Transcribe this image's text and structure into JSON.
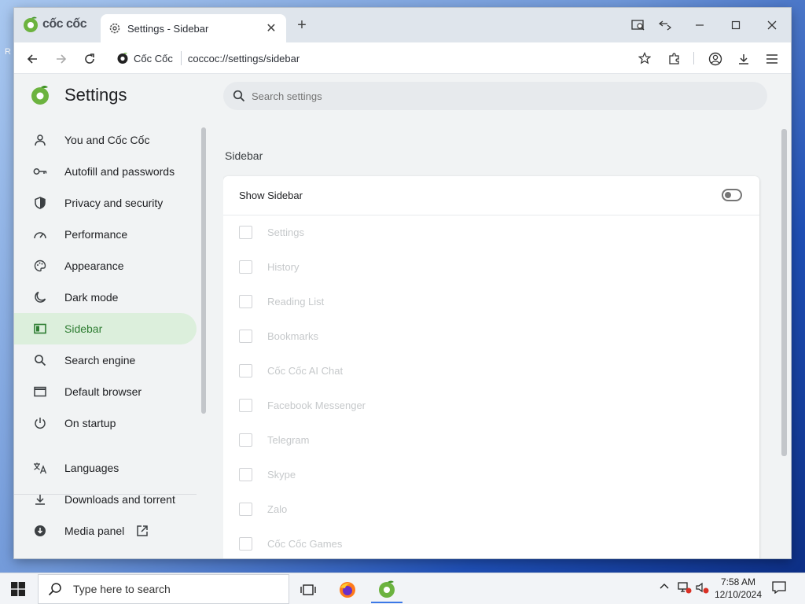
{
  "browser": {
    "brand": "cốc cốc",
    "tab_title": "Settings - Sidebar",
    "site_chip": "Cốc Cốc",
    "url": "coccoc://settings/sidebar"
  },
  "settings": {
    "title": "Settings",
    "search_placeholder": "Search settings",
    "nav": [
      {
        "label": "You and Cốc Cốc",
        "icon": "person-icon",
        "active": false
      },
      {
        "label": "Autofill and passwords",
        "icon": "key-icon",
        "active": false
      },
      {
        "label": "Privacy and security",
        "icon": "shield-icon",
        "active": false
      },
      {
        "label": "Performance",
        "icon": "speedometer-icon",
        "active": false
      },
      {
        "label": "Appearance",
        "icon": "palette-icon",
        "active": false
      },
      {
        "label": "Dark mode",
        "icon": "moon-icon",
        "active": false
      },
      {
        "label": "Sidebar",
        "icon": "sidebar-icon",
        "active": true
      },
      {
        "label": "Search engine",
        "icon": "search-icon",
        "active": false
      },
      {
        "label": "Default browser",
        "icon": "browser-window-icon",
        "active": false
      },
      {
        "label": "On startup",
        "icon": "power-icon",
        "active": false
      },
      {
        "label": "Languages",
        "icon": "translate-icon",
        "active": false
      },
      {
        "label": "Downloads and torrent",
        "icon": "download-icon",
        "active": false
      },
      {
        "label": "Media panel",
        "icon": "media-download-icon",
        "active": false
      }
    ],
    "section_title": "Sidebar",
    "show_sidebar_label": "Show Sidebar",
    "show_sidebar_on": false,
    "sidebar_items": [
      {
        "label": "Settings",
        "checked": false
      },
      {
        "label": "History",
        "checked": false
      },
      {
        "label": "Reading List",
        "checked": false
      },
      {
        "label": "Bookmarks",
        "checked": false
      },
      {
        "label": "Cốc Cốc AI Chat",
        "checked": false
      },
      {
        "label": "Facebook Messenger",
        "checked": false
      },
      {
        "label": "Telegram",
        "checked": false
      },
      {
        "label": "Skype",
        "checked": false
      },
      {
        "label": "Zalo",
        "checked": false
      },
      {
        "label": "Cốc Cốc Games",
        "checked": false
      }
    ]
  },
  "taskbar": {
    "search_placeholder": "Type here to search",
    "time": "7:58 AM",
    "date": "12/10/2024"
  },
  "colors": {
    "accent_green": "#2e7d32",
    "active_nav_bg": "#dcefdc"
  }
}
